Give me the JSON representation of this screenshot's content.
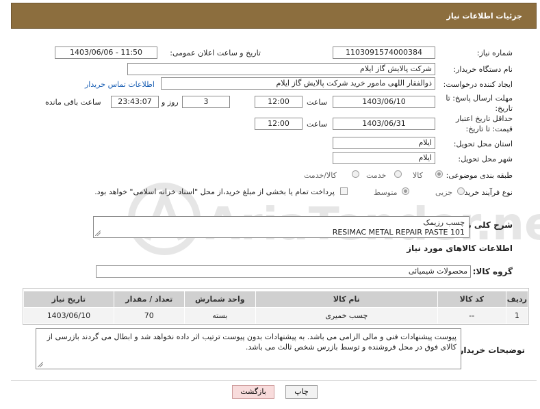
{
  "header": {
    "title": "جزئیات اطلاعات نیاز"
  },
  "fields": {
    "need_number_label": "شماره نیاز:",
    "need_number": "1103091574000384",
    "announce_label": "تاریخ و ساعت اعلان عمومی:",
    "announce_value": "1403/06/06 - 11:50",
    "buyer_label": "نام دستگاه خریدار:",
    "buyer_value": "شرکت پالایش گاز ایلام",
    "creator_label": "ایجاد کننده درخواست:",
    "creator_value": "ذوالفقار اللهی مامور خرید شرکت پالایش گاز ایلام",
    "contact_link": "اطلاعات تماس خریدار",
    "deadline_label": "مهلت ارسال پاسخ: تا تاریخ:",
    "deadline_date": "1403/06/10",
    "time_label": "ساعت",
    "deadline_time": "12:00",
    "days_value": "3",
    "days_label": "روز و",
    "remaining_value": "23:43:07",
    "remaining_label": "ساعت باقی مانده",
    "price_label": "حداقل تاریخ اعتبار قیمت: تا تاریخ:",
    "price_date": "1403/06/31",
    "price_time": "12:00",
    "province_label": "استان محل تحویل:",
    "province_value": "ایلام",
    "city_label": "شهر محل تحویل:",
    "city_value": "ایلام",
    "category_label": "طبقه بندی موضوعی:",
    "category_options": [
      "کالا",
      "خدمت",
      "کالا/خدمت"
    ],
    "process_label": "نوع فرآیند خرید :",
    "process_options": [
      "جزیی",
      "متوسط"
    ],
    "payment_text": "پرداخت تمام یا بخشی از مبلغ خرید،از محل \"اسناد خزانه اسلامی\" خواهد بود."
  },
  "description": {
    "label": "شرح کلی نیاز:",
    "line1": "چسب رزیمک",
    "line2": "RESIMAC METAL REPAIR PASTE 101"
  },
  "goods": {
    "section_title": "اطلاعات کالاهای مورد نیاز",
    "group_label": "گروه کالا:",
    "group_value": "محصولات شیمیائی",
    "columns": [
      "ردیف",
      "کد کالا",
      "نام کالا",
      "واحد شمارش",
      "تعداد / مقدار",
      "تاریخ نیاز"
    ],
    "rows": [
      {
        "row": "1",
        "code": "--",
        "name": "چسب خمیری",
        "unit": "بسته",
        "qty": "70",
        "date": "1403/06/10"
      }
    ]
  },
  "buyer_notes": {
    "label": "توضیحات خریدار:",
    "text": "پیوست پیشنهادات فنی و مالی الزامی می باشد. به پیشنهادات بدون پیوست ترتیب اثر داده نخواهد شد و ابطال می گردند بازرسی از کالای فوق در محل فروشنده و توسط بازرس شخص ثالث می باشد."
  },
  "buttons": {
    "print": "چاپ",
    "back": "بازگشت"
  },
  "watermark": {
    "text": "AriaTender.neT"
  },
  "colors": {
    "header_bg": "#8c6e3e",
    "link": "#1a5fb4"
  }
}
